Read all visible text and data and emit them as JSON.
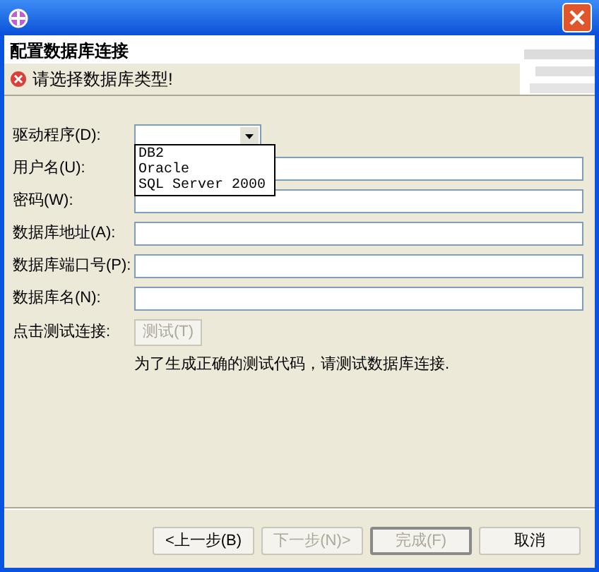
{
  "header": {
    "title": "配置数据库连接",
    "message": "请选择数据库类型!"
  },
  "fields": [
    {
      "label": "驱动程序(D):",
      "kind": "combo",
      "expanded": true,
      "options": [
        {
          "label": "DB2",
          "selected": false
        },
        {
          "label": "Oracle",
          "selected": false
        },
        {
          "label": "SQL Server 2000",
          "selected": false
        }
      ]
    },
    {
      "label": "用户名(U):",
      "kind": "text"
    },
    {
      "label": "密码(W):",
      "kind": "text"
    },
    {
      "label": "数据库地址(A):",
      "kind": "text"
    },
    {
      "label": "数据库端口号(P):",
      "kind": "text"
    },
    {
      "label": "数据库名(N):",
      "kind": "text"
    }
  ],
  "test": {
    "label": "点击测试连接:",
    "button": "测试(T)",
    "disabled": true,
    "note": "为了生成正确的测试代码，请测试数据库连接."
  },
  "buttons": [
    {
      "label": "<上一步(B)",
      "disabled": false,
      "default": false
    },
    {
      "label": "下一步(N)>",
      "disabled": true,
      "default": false
    },
    {
      "label": "完成(F)",
      "disabled": true,
      "default": true
    },
    {
      "label": "取消",
      "disabled": false,
      "default": false
    }
  ]
}
